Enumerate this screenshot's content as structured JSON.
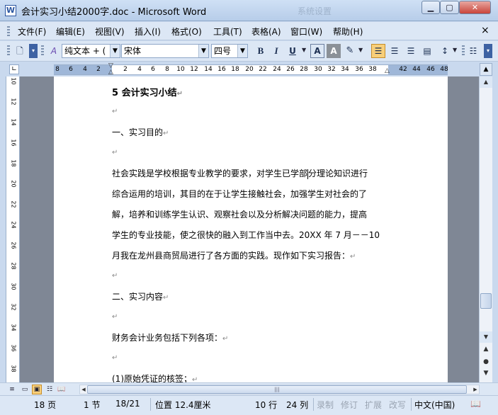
{
  "window": {
    "title": "会计实习小结2000字.doc - Microsoft Word",
    "ghost_tab": "系统设置",
    "app_icon": "W"
  },
  "menu": {
    "items": [
      "文件(F)",
      "编辑(E)",
      "视图(V)",
      "插入(I)",
      "格式(O)",
      "工具(T)",
      "表格(A)",
      "窗口(W)",
      "帮助(H)"
    ],
    "close_doc": "×"
  },
  "toolbar": {
    "style_value": "纯文本 + (",
    "font_value": "宋体",
    "size_value": "四号",
    "bold": "B",
    "italic": "I",
    "underline": "U",
    "font_color": "A",
    "char_shading": "A",
    "align_left_active": true
  },
  "ruler": {
    "ticks": [
      "8",
      "6",
      "4",
      "2",
      "2",
      "4",
      "6",
      "8",
      "10",
      "12",
      "14",
      "16",
      "18",
      "20",
      "22",
      "24",
      "26",
      "28",
      "30",
      "32",
      "34",
      "36",
      "38",
      "42",
      "44",
      "46",
      "48"
    ],
    "vertical_ticks": [
      "10",
      "12",
      "14",
      "16",
      "18",
      "20",
      "22",
      "24",
      "26",
      "28",
      "30",
      "32",
      "34",
      "36",
      "38"
    ]
  },
  "document": {
    "lines": [
      {
        "text": "5 会计实习小结",
        "style": "heading"
      },
      {
        "text": "",
        "style": "blank"
      },
      {
        "text": "一、实习目的",
        "style": "normal"
      },
      {
        "text": "",
        "style": "blank"
      },
      {
        "text_before_caret": "社会实践是学校根据专业教学的要求，对学生已学部",
        "text_after_caret": "分理论知识进行",
        "style": "caret"
      },
      {
        "text": "综合运用的培训，其目的在于让学生接触社会，加强学生对社会的了",
        "style": "normal",
        "no_mark": true
      },
      {
        "text": "解，培养和训练学生认识、观察社会以及分析解决问题的能力，提高",
        "style": "normal",
        "no_mark": true
      },
      {
        "text": "学生的专业技能，使之很快的融入到工作当中去。20XX 年 7 月－－10",
        "style": "normal",
        "no_mark": true
      },
      {
        "text": "月我在龙州县商贸局进行了各方面的实践。现作如下实习报告：",
        "style": "normal"
      },
      {
        "text": "",
        "style": "blank"
      },
      {
        "text": "二、实习内容",
        "style": "normal"
      },
      {
        "text": "",
        "style": "blank"
      },
      {
        "text": "财务会计业务包括下列各项：",
        "style": "normal"
      },
      {
        "text": "",
        "style": "blank"
      },
      {
        "text": "(1)原始凭证的核签；",
        "style": "normal"
      }
    ],
    "paragraph_mark": "↵"
  },
  "status": {
    "page": "18 页",
    "section": "1 节",
    "page_of": "18/21",
    "position": "位置 12.4厘米",
    "line": "10 行",
    "column": "24 列",
    "rec": "录制",
    "trk": "修订",
    "ext": "扩展",
    "ovr": "改写",
    "language": "中文(中国)"
  }
}
